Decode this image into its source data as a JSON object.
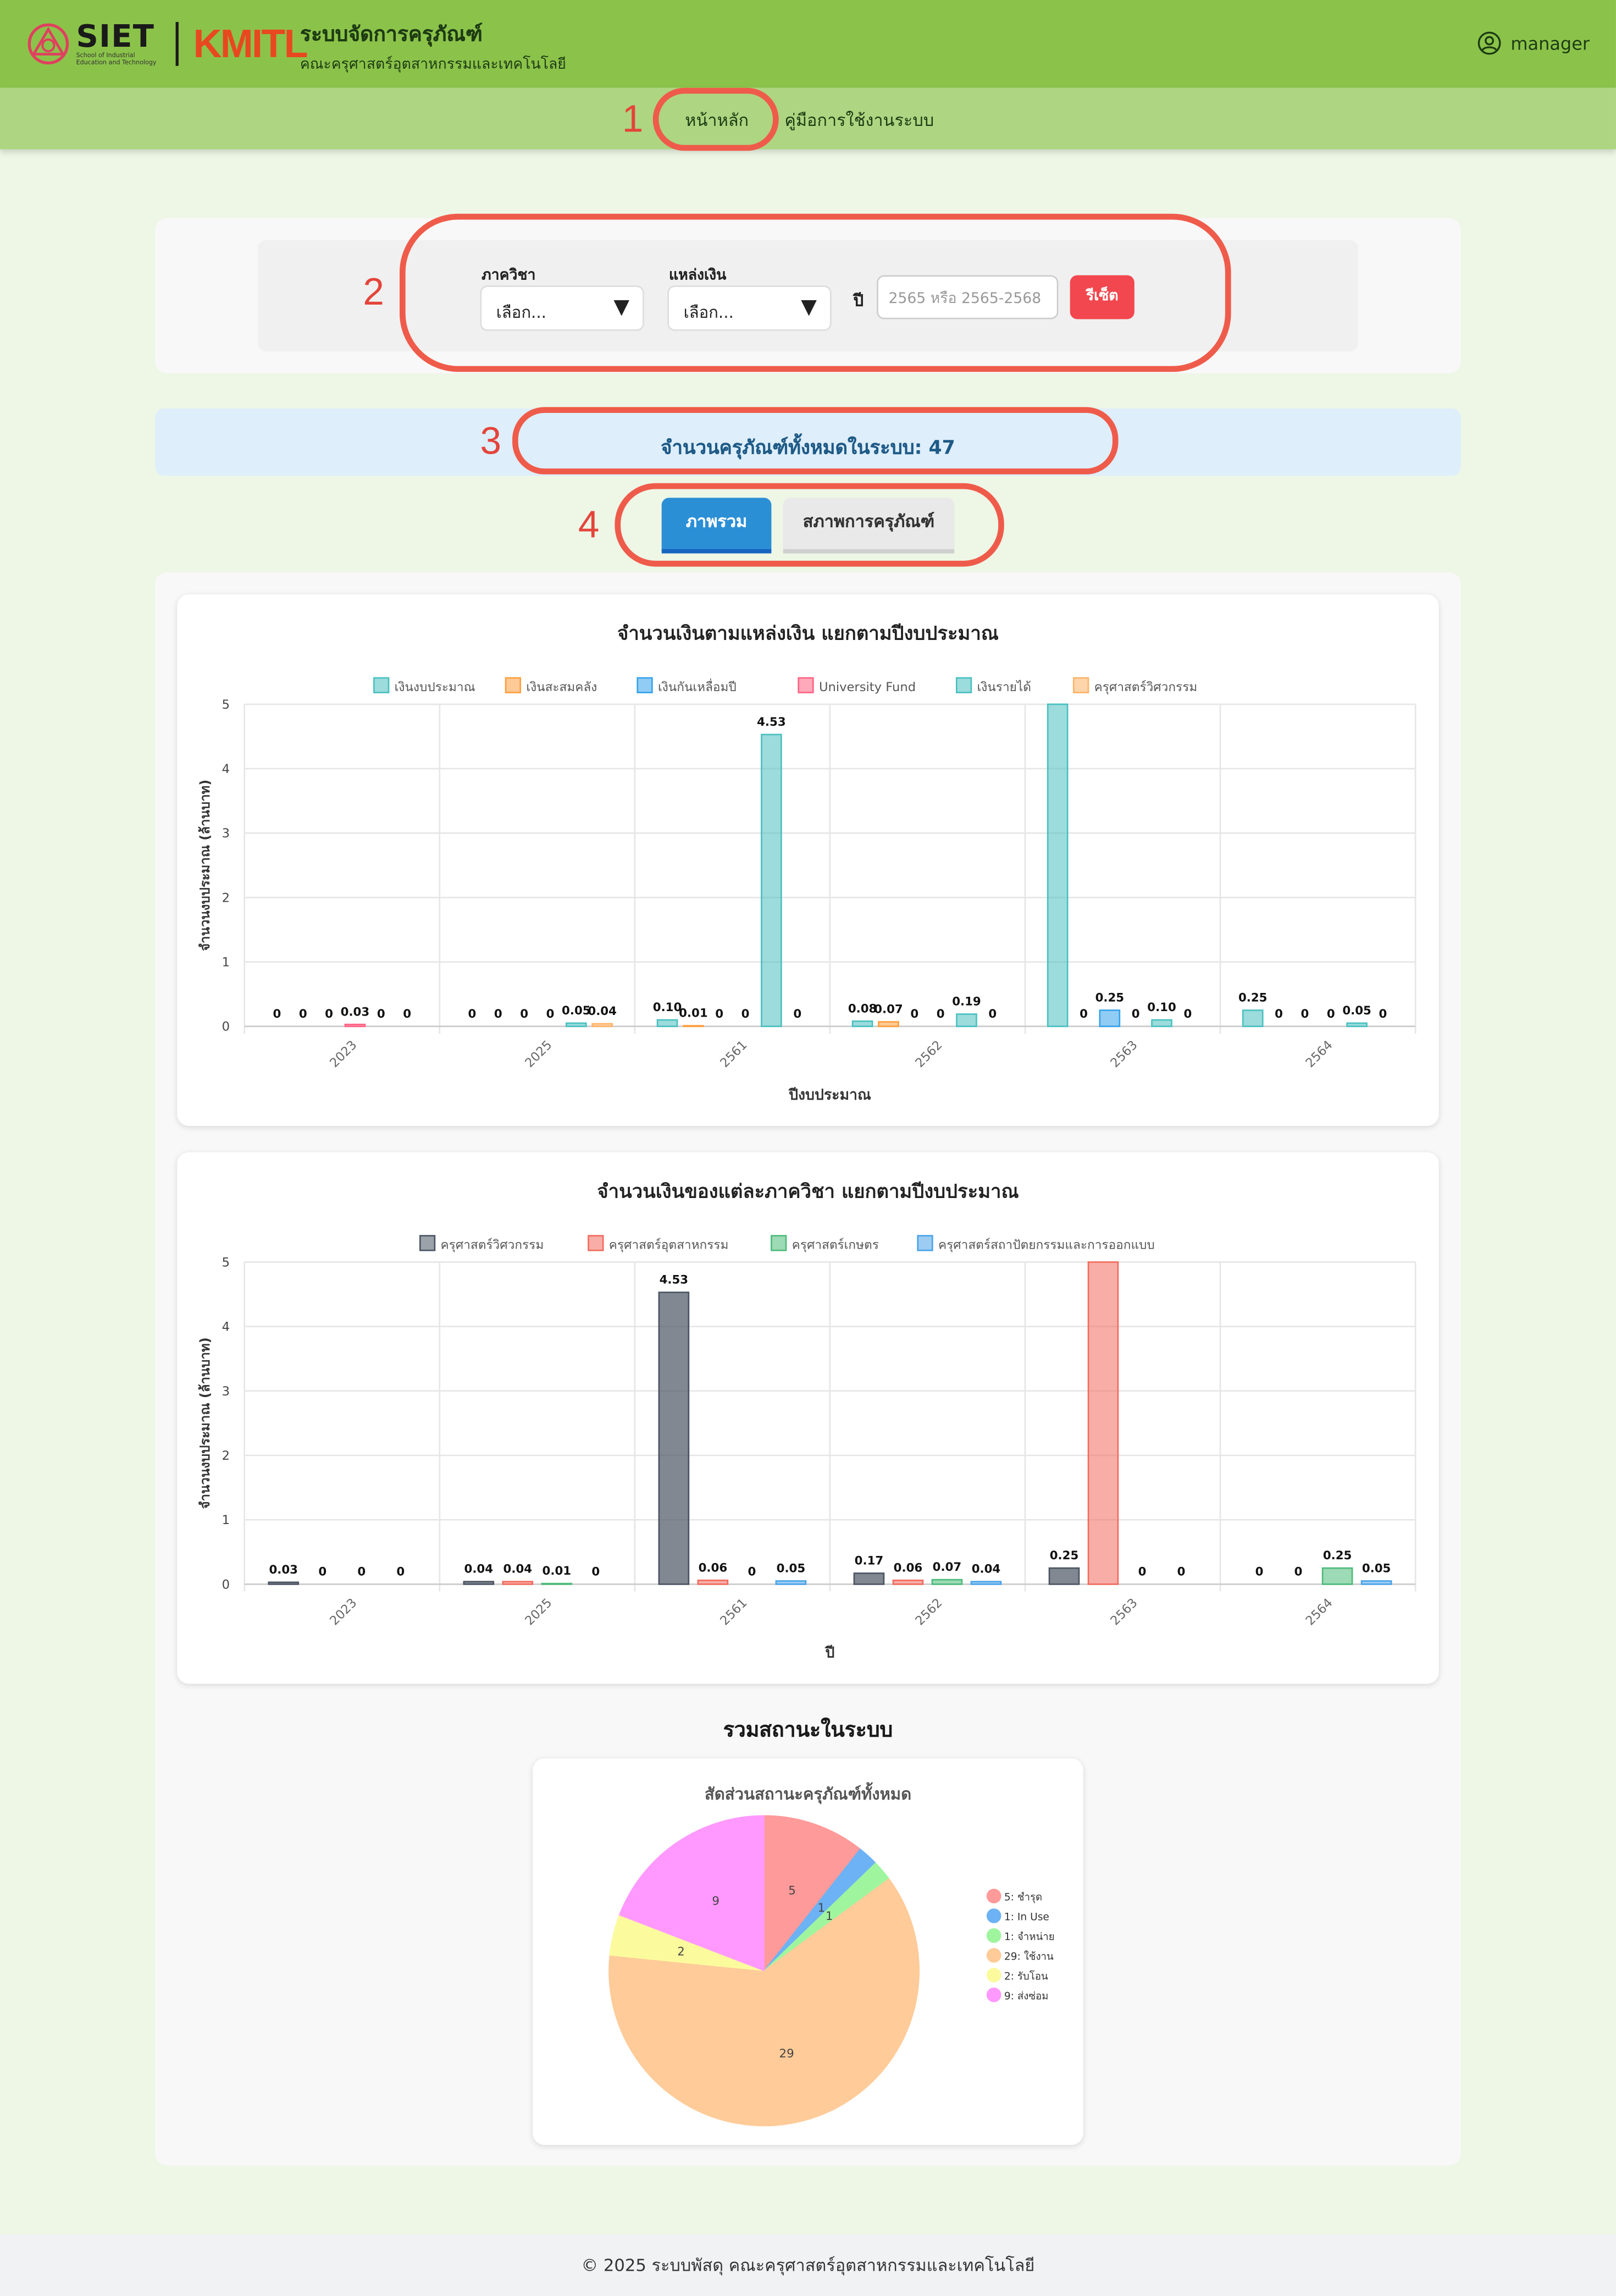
{
  "header": {
    "siet_logo_text": "SIET",
    "siet_logo_sub": "School of Industrial Education and Technology",
    "kmitl_logo_text": "KMITL",
    "app_title": "ระบบจัดการครุภัณฑ์",
    "app_subtitle": "คณะครุศาสตร์อุตสาหกรรมและเทคโนโลยี",
    "username": "manager"
  },
  "nav": {
    "items": [
      {
        "label": "หน้าหลัก",
        "active": true
      },
      {
        "label": "คู่มือการใช้งานระบบ",
        "active": false
      }
    ]
  },
  "annotations": [
    "1",
    "2",
    "3",
    "4"
  ],
  "filters": {
    "department_label": "ภาควิชา",
    "department_value": "เลือก...",
    "fund_label": "แหล่งเงิน",
    "fund_value": "เลือก...",
    "year_label": "ปี",
    "year_placeholder": "2565 หรือ 2565-2568",
    "reset_label": "รีเซ็ต"
  },
  "summary": {
    "total_text": "จำนวนครุภัณฑ์ทั้งหมดในระบบ: 47"
  },
  "tabs": [
    {
      "label": "ภาพรวม",
      "active": true
    },
    {
      "label": "สภาพการครุภัณฑ์",
      "active": false
    }
  ],
  "status_section_title": "รวมสถานะในระบบ",
  "footer_text": "© 2025 ระบบพัสดุ คณะครุศาสตร์อุตสาหกรรมและเทคโนโลยี",
  "colors": {
    "header_green": "#8bc34a",
    "nav_green": "#aed581",
    "tab_blue": "#2b8fd6",
    "reset_red": "#f2474e",
    "annotation_red": "#ef5b4a"
  },
  "chart_data": [
    {
      "type": "bar",
      "title": "จำนวนเงินตามแหล่งเงิน แยกตามปีงบประมาณ",
      "xlabel": "ปีงบประมาณ",
      "ylabel": "จำนวนงบประมาณ (ล้านบาท)",
      "ylim": [
        0,
        5
      ],
      "yticks": [
        "0",
        "1",
        "2",
        "3",
        "4",
        "5"
      ],
      "categories": [
        "2023",
        "2025",
        "2561",
        "2562",
        "2563",
        "2564"
      ],
      "legend_position": "top",
      "series": [
        {
          "name": "เงินงบประมาณ",
          "color": "#4bc0c0",
          "values": [
            0,
            0,
            0.1,
            0.08,
            5.0,
            0.25
          ],
          "labels": [
            "0",
            "0",
            "0.10",
            "0.08",
            "",
            "0.25"
          ]
        },
        {
          "name": "เงินสะสมคลัง",
          "color": "#ff9f40",
          "values": [
            0,
            0,
            0.01,
            0.07,
            0,
            0
          ],
          "labels": [
            "0",
            "0",
            "0.01",
            "0.07",
            "0",
            "0"
          ]
        },
        {
          "name": "เงินกันเหลื่อมปี",
          "color": "#36a2eb",
          "values": [
            0,
            0,
            0,
            0,
            0.25,
            0
          ],
          "labels": [
            "0",
            "0",
            "0",
            "0",
            "0.25",
            "0"
          ]
        },
        {
          "name": "University Fund",
          "color": "#ff6384",
          "values": [
            0.03,
            0,
            0,
            0,
            0,
            0
          ],
          "labels": [
            "0.03",
            "0",
            "0",
            "0",
            "0",
            "0"
          ]
        },
        {
          "name": "เงินรายได้",
          "color": "#4bc0c0",
          "values": [
            0,
            0.05,
            4.53,
            0.19,
            0.1,
            0.05
          ],
          "labels": [
            "0",
            "0.05",
            "4.53",
            "0.19",
            "0.10",
            "0.05"
          ]
        },
        {
          "name": "ครุศาสตร์วิศวกรรม",
          "color": "#ffb366",
          "values": [
            0,
            0.04,
            0,
            0,
            0,
            0
          ],
          "labels": [
            "0",
            "0.04",
            "0",
            "0",
            "0",
            "0"
          ]
        }
      ]
    },
    {
      "type": "bar",
      "title": "จำนวนเงินของแต่ละภาควิชา แยกตามปีงบประมาณ",
      "xlabel": "ปี",
      "ylabel": "จำนวนงบประมาณ (ล้านบาท)",
      "ylim": [
        0,
        5
      ],
      "yticks": [
        "0",
        "1",
        "2",
        "3",
        "4",
        "5"
      ],
      "categories": [
        "2023",
        "2025",
        "2561",
        "2562",
        "2563",
        "2564"
      ],
      "legend_position": "top",
      "series": [
        {
          "name": "ครุศาสตร์วิศวกรรม",
          "color": "#4b5563",
          "values": [
            0.03,
            0.04,
            4.53,
            0.17,
            0.25,
            0
          ],
          "labels": [
            "0.03",
            "0.04",
            "4.53",
            "0.17",
            "0.25",
            "0"
          ]
        },
        {
          "name": "ครุศาสตร์อุตสาหกรรม",
          "color": "#f26b5e",
          "values": [
            0,
            0.04,
            0.06,
            0.06,
            5.0,
            0
          ],
          "labels": [
            "0",
            "0.04",
            "0.06",
            "0.06",
            "",
            "0"
          ]
        },
        {
          "name": "ครุศาสตร์เกษตร",
          "color": "#4cbb7a",
          "values": [
            0,
            0.01,
            0,
            0.07,
            0,
            0.25
          ],
          "labels": [
            "0",
            "0.01",
            "0",
            "0.07",
            "0",
            "0.25"
          ]
        },
        {
          "name": "ครุศาสตร์สถาปัตยกรรมและการออกแบบ",
          "color": "#4aa3e8",
          "values": [
            0,
            0,
            0.05,
            0.04,
            0,
            0.05
          ],
          "labels": [
            "0",
            "0",
            "0.05",
            "0.04",
            "0",
            "0.05"
          ]
        }
      ]
    },
    {
      "type": "pie",
      "title": "สัดส่วนสถานะครุภัณฑ์ทั้งหมด",
      "legend_position": "right",
      "slices": [
        {
          "label": "5: ชำรุด",
          "value": 5,
          "color": "#ff9a9a"
        },
        {
          "label": "1: In Use",
          "value": 1,
          "color": "#6cb2f5"
        },
        {
          "label": "1: จำหน่าย",
          "value": 1,
          "color": "#9ef59e"
        },
        {
          "label": "29: ใช้งาน",
          "value": 29,
          "color": "#ffcb99"
        },
        {
          "label": "2: รับโอน",
          "value": 2,
          "color": "#fbfb9e"
        },
        {
          "label": "9: ส่งซ่อม",
          "value": 9,
          "color": "#ff99ff"
        }
      ]
    }
  ]
}
